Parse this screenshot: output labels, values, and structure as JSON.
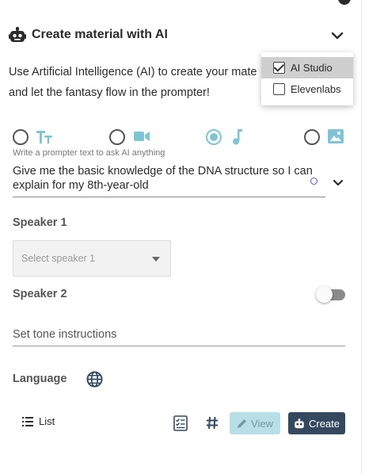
{
  "panel": {
    "title": "Create material with AI",
    "description_line1": "Use Artificial Intelligence (AI) to create your mate",
    "description_line2": "and let the fantasy flow in the prompter!"
  },
  "provider_menu": {
    "items": [
      {
        "label": "AI Studio",
        "checked": true
      },
      {
        "label": "Elevenlabs",
        "checked": false
      }
    ]
  },
  "modes": {
    "options": [
      "text-icon",
      "video-icon",
      "music-icon",
      "image-icon"
    ],
    "selected": "music-icon"
  },
  "prompt": {
    "hint": "Write a prompter text to ask AI anything",
    "value": "Give me the basic knowledge of the DNA structure so I can explain for my 8th-year-old"
  },
  "speaker1": {
    "label": "Speaker 1",
    "placeholder": "Select speaker 1"
  },
  "speaker2": {
    "label": "Speaker 2",
    "enabled": false
  },
  "tone": {
    "placeholder": "Set tone instructions"
  },
  "language": {
    "label": "Language"
  },
  "toolbar": {
    "list_label": "List",
    "view_label": "View",
    "create_label": "Create"
  },
  "colors": {
    "accent": "#7fc4d4",
    "create_button": "#34495e",
    "view_button": "#b8dee6"
  }
}
